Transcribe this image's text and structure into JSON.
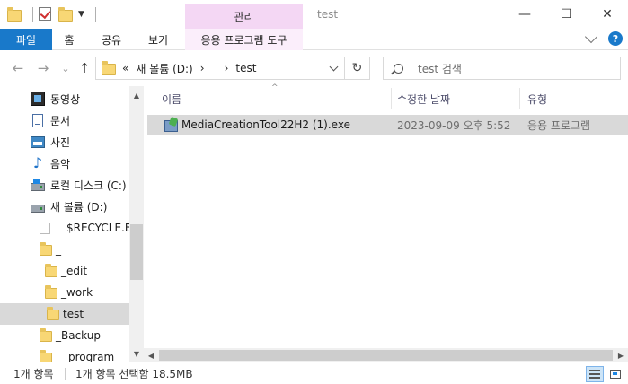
{
  "window": {
    "title": "test",
    "minimize": "—",
    "maximize": "☐",
    "close": "✕"
  },
  "ribbon": {
    "context_group": "관리",
    "tabs": [
      {
        "label": "파일"
      },
      {
        "label": "홈"
      },
      {
        "label": "공유"
      },
      {
        "label": "보기"
      },
      {
        "label": "응용 프로그램 도구"
      }
    ],
    "help": "?"
  },
  "address": {
    "back": "←",
    "forward": "→",
    "recent": "⌄",
    "up": "↑",
    "crumbs": [
      "«",
      "새 볼륨 (D:)",
      "›",
      "_",
      "›",
      "test"
    ],
    "refresh": "↻",
    "search_placeholder": "test 검색"
  },
  "nav": {
    "items": [
      {
        "label": "동영상",
        "icon": "video-icon"
      },
      {
        "label": "문서",
        "icon": "document-icon"
      },
      {
        "label": "사진",
        "icon": "picture-icon"
      },
      {
        "label": "음악",
        "icon": "music-icon"
      },
      {
        "label": "로컬 디스크 (C:)",
        "icon": "local-disk-icon"
      },
      {
        "label": "새 볼륨 (D:)",
        "icon": "drive-icon"
      },
      {
        "label": "$RECYCLE.BIN",
        "icon": "recycle-folder-icon"
      },
      {
        "label": "_",
        "icon": "folder-icon"
      },
      {
        "label": "_edit",
        "icon": "folder-icon"
      },
      {
        "label": "_work",
        "icon": "folder-icon"
      },
      {
        "label": "test",
        "icon": "folder-icon",
        "selected": true
      },
      {
        "label": "_Backup",
        "icon": "folder-icon"
      },
      {
        "label": "program",
        "icon": "folder-icon"
      }
    ]
  },
  "filelist": {
    "columns": [
      "이름",
      "수정한 날짜",
      "유형"
    ],
    "sort_indicator": "^",
    "rows": [
      {
        "name": "MediaCreationTool22H2 (1).exe",
        "modified": "2023-09-09 오후 5:52",
        "type": "응용 프로그램"
      }
    ]
  },
  "status": {
    "item_count": "1개 항목",
    "selection": "1개 항목 선택함 18.5MB"
  }
}
